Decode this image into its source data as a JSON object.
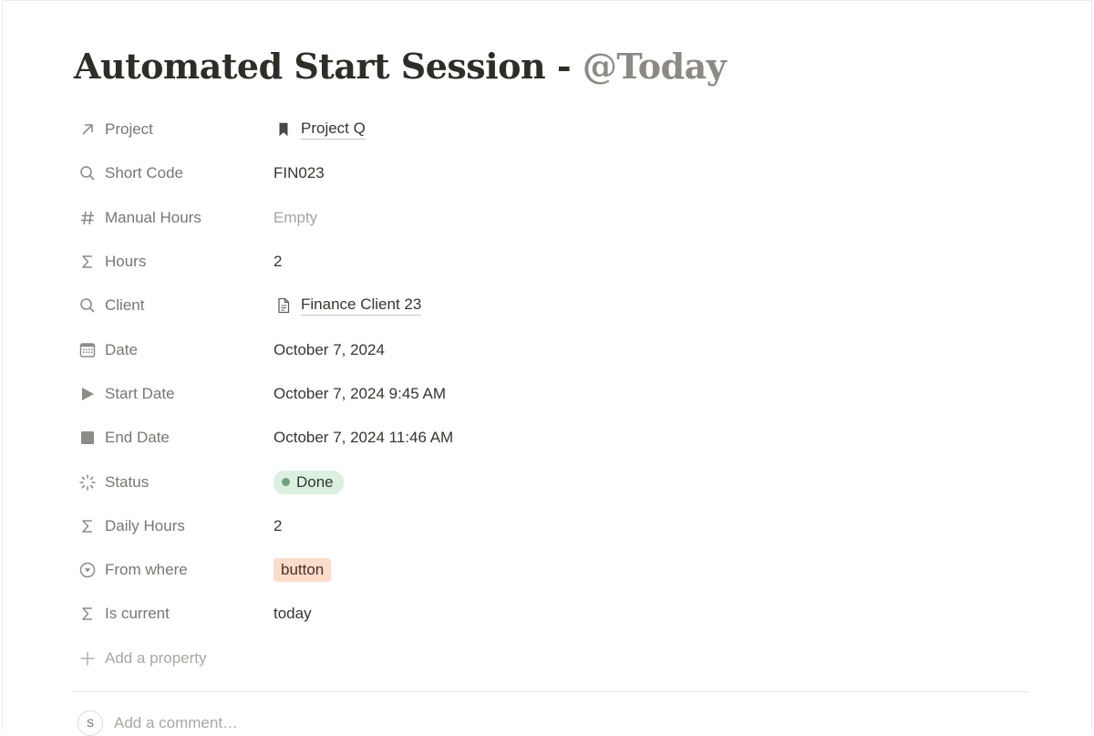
{
  "page": {
    "title": "Automated Start Session - ",
    "title_mention": "@Today"
  },
  "properties": [
    {
      "icon": "arrow-up-right-icon",
      "label": "Project",
      "value": "Project Q",
      "value_icon": "bookmark-icon",
      "kind": "relation"
    },
    {
      "icon": "search-icon",
      "label": "Short Code",
      "value": "FIN023",
      "kind": "text"
    },
    {
      "icon": "hash-icon",
      "label": "Manual Hours",
      "value": "Empty",
      "kind": "empty"
    },
    {
      "icon": "sigma-icon",
      "label": "Hours",
      "value": "2",
      "kind": "formula"
    },
    {
      "icon": "search-icon",
      "label": "Client",
      "value": "Finance Client 23",
      "value_icon": "document-icon",
      "kind": "relation"
    },
    {
      "icon": "calendar-icon",
      "label": "Date",
      "value": "October 7, 2024",
      "kind": "date"
    },
    {
      "icon": "play-icon",
      "label": "Start Date",
      "value": "October 7, 2024 9:45 AM",
      "kind": "date"
    },
    {
      "icon": "stop-icon",
      "label": "End Date",
      "value": "October 7, 2024 11:46 AM",
      "kind": "date"
    },
    {
      "icon": "status-spinner-icon",
      "label": "Status",
      "value": "Done",
      "kind": "status",
      "color": "#dcefe0",
      "dot_color": "#6ea07c"
    },
    {
      "icon": "sigma-icon",
      "label": "Daily Hours",
      "value": "2",
      "kind": "formula"
    },
    {
      "icon": "select-circle-icon",
      "label": "From where",
      "value": "button",
      "kind": "select",
      "color": "#fbdccb"
    },
    {
      "icon": "sigma-icon",
      "label": "Is current",
      "value": "today",
      "kind": "formula"
    }
  ],
  "add_property": {
    "icon": "plus-icon",
    "label": "Add a property"
  },
  "comment": {
    "avatar_initial": "S",
    "placeholder": "Add a comment…"
  }
}
